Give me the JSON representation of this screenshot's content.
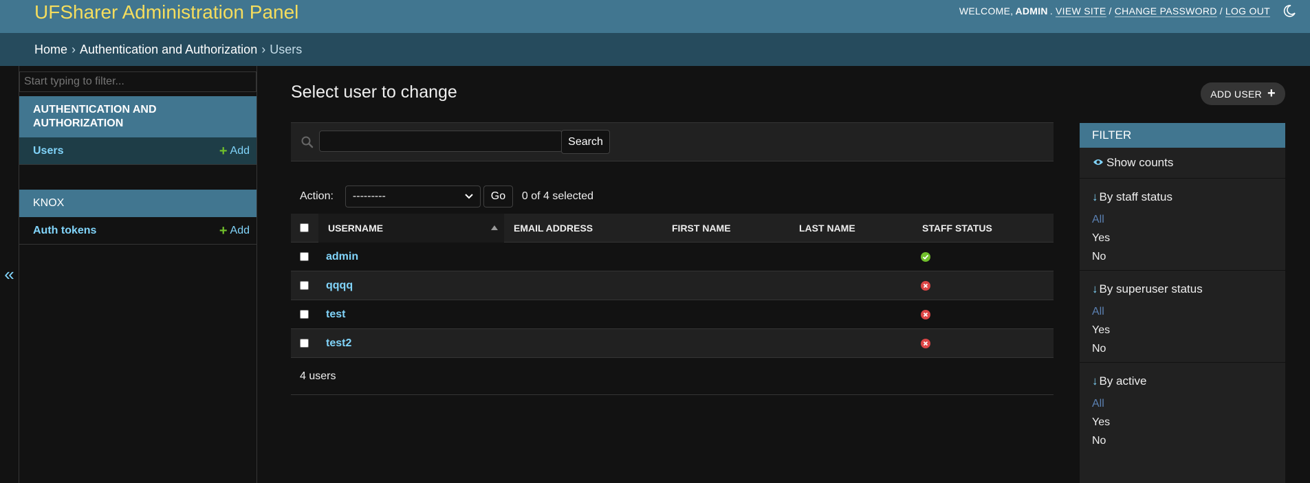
{
  "header": {
    "site_title": "UFSharer Administration Panel",
    "welcome": "WELCOME,",
    "username": "ADMIN",
    "view_site": "VIEW SITE",
    "change_password": "CHANGE PASSWORD",
    "log_out": "LOG OUT",
    "sep1": ".",
    "sep2": "/",
    "sep3": "/"
  },
  "breadcrumbs": {
    "home": "Home",
    "app": "Authentication and Authorization",
    "current": "Users",
    "sep": "›"
  },
  "sidebar": {
    "filter_placeholder": "Start typing to filter...",
    "apps": [
      {
        "caption": "AUTHENTICATION AND AUTHORIZATION",
        "models": [
          {
            "name": "Users",
            "add": "Add"
          }
        ]
      },
      {
        "caption": "KNOX",
        "models": [
          {
            "name": "Auth tokens",
            "add": "Add"
          }
        ]
      }
    ],
    "collapse": "«"
  },
  "content": {
    "title": "Select user to change",
    "add_user": "ADD USER",
    "search_button": "Search",
    "action_label": "Action:",
    "action_selected": "---------",
    "go_button": "Go",
    "selection_count": "0 of 4 selected",
    "columns": {
      "username": "USERNAME",
      "email": "EMAIL ADDRESS",
      "first_name": "FIRST NAME",
      "last_name": "LAST NAME",
      "staff_status": "STAFF STATUS"
    },
    "rows": [
      {
        "username": "admin",
        "staff": true
      },
      {
        "username": "qqqq",
        "staff": false
      },
      {
        "username": "test",
        "staff": false
      },
      {
        "username": "test2",
        "staff": false
      }
    ],
    "paginator": "4 users"
  },
  "filter": {
    "title": "FILTER",
    "show_counts": "Show counts",
    "arrow": "↓",
    "groups": [
      {
        "title": "By staff status",
        "options": [
          "All",
          "Yes",
          "No"
        ]
      },
      {
        "title": "By superuser status",
        "options": [
          "All",
          "Yes",
          "No"
        ]
      },
      {
        "title": "By active",
        "options": [
          "All",
          "Yes",
          "No"
        ]
      }
    ]
  },
  "colors": {
    "header_bg": "#417690",
    "breadcrumb_bg": "#264b5d",
    "title_yellow": "#f5dd5d",
    "link": "#81d4fa",
    "yes_green": "#70bf2b",
    "no_red": "#dd4646"
  },
  "icons": {
    "theme": "moon-icon",
    "search": "search-icon",
    "plus": "plus-icon",
    "eye": "eye-icon",
    "yes": "check-circle-icon",
    "no": "x-circle-icon"
  }
}
